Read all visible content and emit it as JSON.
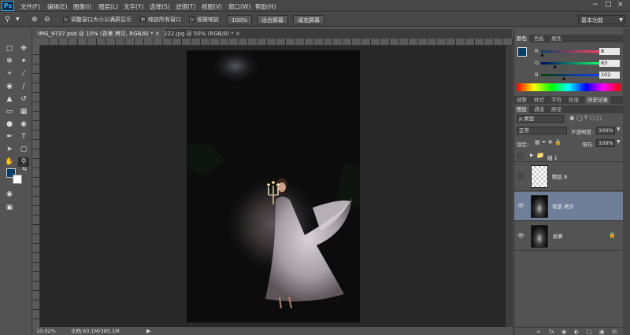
{
  "app": {
    "logo": "Ps"
  },
  "menu": [
    "文件(F)",
    "编辑(E)",
    "图像(I)",
    "图层(L)",
    "文字(Y)",
    "选择(S)",
    "滤镜(T)",
    "视图(V)",
    "窗口(W)",
    "帮助(H)"
  ],
  "window_controls": {
    "minimize": "−",
    "maximize": "□",
    "close": "×"
  },
  "options_bar": {
    "resize_windows": "调整窗口大小以满屏显示",
    "zoom_all": "缩放所有窗口",
    "scrubby_zoom": "细微缩放",
    "actual_pixels": "100%",
    "fit_screen": "适合屏幕",
    "fill_screen": "填充屏幕",
    "workspace": "基本功能"
  },
  "doc_tabs": [
    {
      "label": "IMG_9737.psd @ 10% (背景 拷贝, RGB/8) *",
      "close": "×"
    },
    {
      "label": "222.jpg @ 50% (RGB/8) *",
      "close": "×"
    }
  ],
  "status": {
    "zoom": "10.02%",
    "doc": "文档:63.1M/385.1M"
  },
  "color_panel": {
    "tabs": [
      "颜色",
      "色板",
      "属性"
    ],
    "channels": [
      {
        "label": "R",
        "value": "8",
        "fraction": 0.03
      },
      {
        "label": "G",
        "value": "63",
        "fraction": 0.25
      },
      {
        "label": "B",
        "value": "102",
        "fraction": 0.4
      }
    ],
    "fg_color": "#083f66"
  },
  "adjust_tabs": [
    "调整",
    "样式",
    "字符",
    "段落",
    "历史记录"
  ],
  "layers_panel": {
    "tabs": [
      "图层",
      "通道",
      "路径"
    ],
    "filter": "ρ 类型",
    "blend_mode": "正常",
    "opacity_label": "不透明度:",
    "opacity": "100%",
    "lock_label": "锁定:",
    "fill_label": "填充:",
    "fill": "100%",
    "layers": [
      {
        "name": "组 1",
        "type": "group"
      },
      {
        "name": "图层 8",
        "type": "transparent"
      },
      {
        "name": "背景 拷贝",
        "type": "photo",
        "active": true
      },
      {
        "name": "背景",
        "type": "photo",
        "locked": true
      }
    ]
  }
}
